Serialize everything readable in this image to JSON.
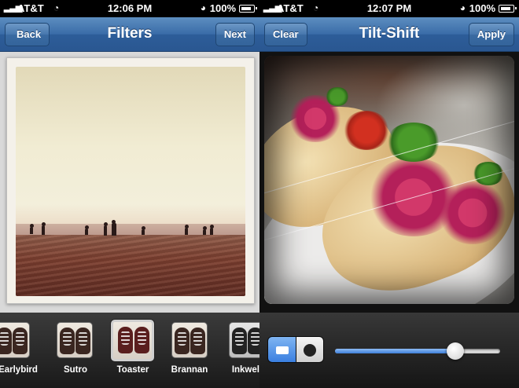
{
  "left_screen": {
    "status_bar": {
      "signal": "▂▃▅",
      "carrier": "AT&T",
      "wifi_icon": "wifi-icon",
      "time": "12:06 PM",
      "lock_icon": "rotation-lock-icon",
      "battery": "100%"
    },
    "nav": {
      "back_label": "Back",
      "title": "Filters",
      "next_label": "Next"
    },
    "filters": [
      {
        "label": "Earlybird",
        "selected": false
      },
      {
        "label": "Sutro",
        "selected": false
      },
      {
        "label": "Toaster",
        "selected": true
      },
      {
        "label": "Brannan",
        "selected": false
      },
      {
        "label": "Inkwell",
        "selected": false
      }
    ]
  },
  "right_screen": {
    "status_bar": {
      "signal": "▂▃▅",
      "carrier": "AT&T",
      "wifi_icon": "wifi-icon",
      "time": "12:07 PM",
      "lock_icon": "rotation-lock-icon",
      "battery": "100%"
    },
    "nav": {
      "clear_label": "Clear",
      "title": "Tilt-Shift",
      "apply_label": "Apply"
    },
    "tilt_mode": {
      "options": [
        "linear",
        "radial"
      ],
      "selected": "linear"
    },
    "blur_slider": {
      "value": 0.73
    }
  }
}
